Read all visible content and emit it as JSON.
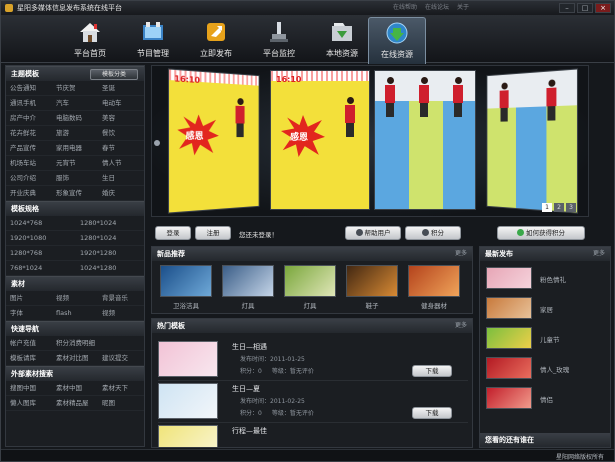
{
  "window": {
    "title": "星阳多媒体信息发布系统在线平台",
    "links": [
      "在线帮助",
      "在线论坛",
      "关于"
    ],
    "min": "–",
    "max": "□",
    "close": "×"
  },
  "nav": [
    {
      "label": "平台首页",
      "icon": "home-icon"
    },
    {
      "label": "节目管理",
      "icon": "program-icon"
    },
    {
      "label": "立即发布",
      "icon": "publish-icon"
    },
    {
      "label": "平台监控",
      "icon": "monitor-icon"
    },
    {
      "label": "本地资源",
      "icon": "local-resource-icon"
    },
    {
      "label": "在线资源",
      "icon": "online-resource-icon",
      "active": true
    }
  ],
  "sidebar": {
    "theme": {
      "title": "主题模板",
      "button": "模板分类",
      "items": [
        "公告通知",
        "节庆贺",
        "圣诞",
        "通讯手机",
        "汽车",
        "电动车",
        "房产中介",
        "电脑数码",
        "美容",
        "花卉鲜花",
        "旅游",
        "餐饮",
        "产品宣传",
        "家用电器",
        "春节",
        "机场车站",
        "元宵节",
        "情人节",
        "公司介绍",
        "服饰",
        "生日",
        "开业庆典",
        "形象宣传",
        "婚庆"
      ]
    },
    "sizes": {
      "title": "模板规格",
      "items": [
        "1024*768",
        "1280*1024",
        "1920*1080",
        "1280*1024",
        "1280*768",
        "1920*1280",
        "768*1024",
        "1024*1280"
      ]
    },
    "material": {
      "title": "素材",
      "items": [
        "图片",
        "视频",
        "背景音乐",
        "字体",
        "flash",
        "视频"
      ]
    },
    "service": {
      "title": "快速导航",
      "items": [
        "帐户充值",
        "积分消费明细",
        "",
        "模板请库",
        "素材对比图",
        "建议提交"
      ]
    },
    "external": {
      "title": "外部素材搜索",
      "items": [
        "搜图中国",
        "素材中国",
        "素材天下",
        "懒人图库",
        "素材精品屋",
        "昵图"
      ]
    }
  },
  "carousel": {
    "banner_text": "感恩",
    "date_label": "16:10",
    "pages": [
      "1",
      "2",
      "3"
    ],
    "active_page": 0
  },
  "login": {
    "login_label": "登录",
    "register_label": "注册",
    "status": "您还未登录！",
    "help_label": "帮助用户",
    "points_label": "积分",
    "get_points_label": "如何获得积分"
  },
  "new_recommend": {
    "title": "新品推荐",
    "more": "更多",
    "items": [
      {
        "caption": "卫浴洁具",
        "colors": [
          "#1b4f8a",
          "#6fa9d8"
        ]
      },
      {
        "caption": "灯具",
        "colors": [
          "#3b5e88",
          "#c5d5e8"
        ]
      },
      {
        "caption": "灯具",
        "colors": [
          "#7aa73c",
          "#e0e6b8"
        ]
      },
      {
        "caption": "鞋子",
        "colors": [
          "#432812",
          "#d88a34"
        ]
      },
      {
        "caption": "健身器材",
        "colors": [
          "#b4431c",
          "#f0a45a"
        ]
      }
    ]
  },
  "hot_templates": {
    "title": "热门模板",
    "more": "更多",
    "download_label": "下载",
    "items": [
      {
        "name": "生日—相遇",
        "time": "发布时间：2011-01-25",
        "points": "积分：0",
        "rating": "等级：暂无评价",
        "colors": [
          "#f2c3d6",
          "#f8e7ef"
        ]
      },
      {
        "name": "生日—夏",
        "time": "发布时间：2011-02-25",
        "points": "积分：0",
        "rating": "等级：暂无评价",
        "colors": [
          "#cfe4f3",
          "#f2f6fa"
        ]
      },
      {
        "name": "行程—最佳",
        "time": "",
        "points": "",
        "rating": "",
        "colors": [
          "#f0e47a",
          "#f9f6d6"
        ]
      }
    ]
  },
  "latest_publish": {
    "title": "最新发布",
    "more": "更多",
    "items": [
      {
        "label": "粉色情礼",
        "colors": [
          "#e7a6b6",
          "#f5d3dc"
        ]
      },
      {
        "label": "家居",
        "colors": [
          "#c87a3c",
          "#e8c29a"
        ]
      },
      {
        "label": "儿童节",
        "colors": [
          "#7bbf3e",
          "#eecf49"
        ]
      },
      {
        "label": "情人_玫瑰",
        "colors": [
          "#b31a23",
          "#e96e5e"
        ]
      },
      {
        "label": "情侣",
        "colors": [
          "#c21f2b",
          "#f29b8c"
        ]
      }
    ],
    "footer": "您看的还有谁在"
  },
  "statusbar": {
    "right": "星阳网络版权所有"
  }
}
